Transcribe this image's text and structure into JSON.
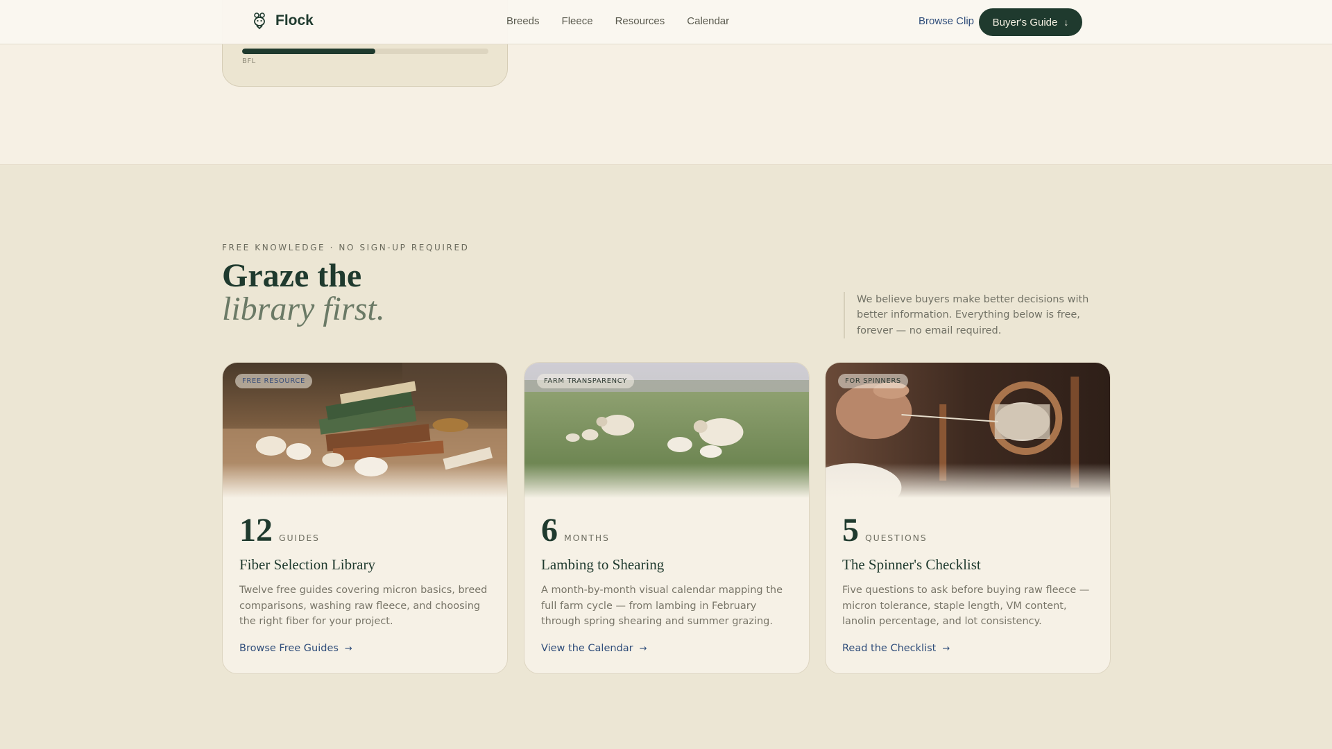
{
  "header": {
    "logo_text": "Flock",
    "nav": [
      "Breeds",
      "Fleece",
      "Resources",
      "Calendar"
    ],
    "browse_clip": "Browse Clip",
    "buyers_guide": "Buyer's Guide"
  },
  "previous_card": {
    "label": "BFL",
    "progress_fraction": 0.54
  },
  "library": {
    "eyebrow": "FREE KNOWLEDGE · NO SIGN-UP REQUIRED",
    "heading_line1": "Graze the",
    "heading_line2": "library first.",
    "intro": "We believe buyers make better decisions with better information. Everything below is free, forever — no email required.",
    "cards": [
      {
        "tag": "FREE RESOURCE",
        "number": "12",
        "unit": "GUIDES",
        "title": "Fiber Selection Library",
        "description": "Twelve free guides covering micron basics, breed comparisons, washing raw fleece, and choosing the right fiber for your project.",
        "link": "Browse Free Guides"
      },
      {
        "tag": "FARM TRANSPARENCY",
        "number": "6",
        "unit": "MONTHS",
        "title": "Lambing to Shearing",
        "description": "A month-by-month visual calendar mapping the full farm cycle — from lambing in February through spring shearing and summer grazing.",
        "link": "View the Calendar"
      },
      {
        "tag": "FOR SPINNERS",
        "number": "5",
        "unit": "QUESTIONS",
        "title": "The Spinner's Checklist",
        "description": "Five questions to ask before buying raw fleece — micron tolerance, staple length, VM content, lanolin percentage, and lot consistency.",
        "link": "Read the Checklist"
      }
    ]
  },
  "colors": {
    "primary": "#1f3a2e",
    "link": "#2f4d7a",
    "background": "#f6f0e4",
    "section_background": "#ece6d4"
  },
  "icons": {
    "logo": "sheep-icon",
    "buyers_guide": "arrow-down-icon",
    "card_link": "arrow-right-icon"
  }
}
